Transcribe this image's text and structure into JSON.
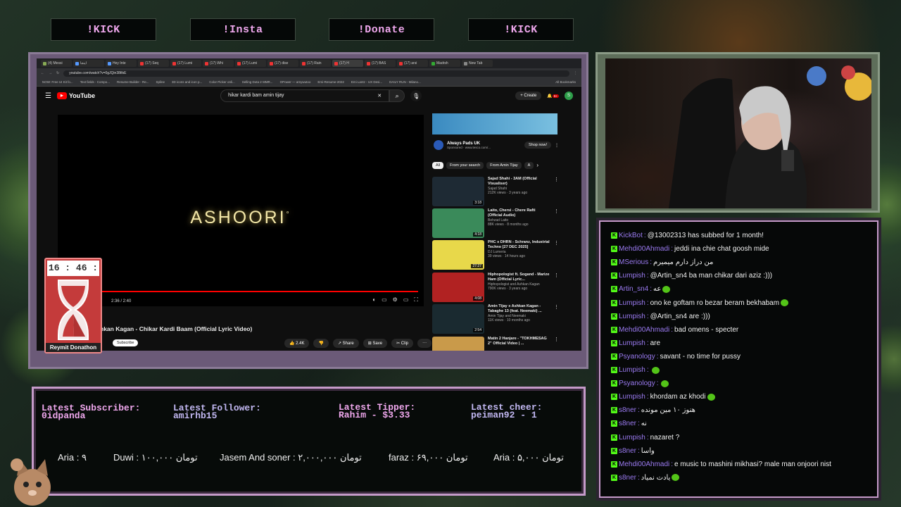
{
  "top_buttons": [
    "!KICK",
    "!Insta",
    "!Donate",
    "!KICK"
  ],
  "browser": {
    "tabs": [
      "(4) Messi",
      "اینجا",
      "Hey Inte",
      "(17) Seq",
      "(17) Lumi",
      "(17) Whi",
      "(17) Lumi",
      "(17) dise",
      "(17) Rain",
      "(17) H",
      "(17) BAS",
      "(17) arsi",
      "Madrsh",
      "New Tab"
    ],
    "url": "youtube.com/watch?v=0gJQin38tfsE",
    "bookmarks": [
      "NOW: Free UI Kit fo...",
      "Text fields - Compo...",
      "Resume Builder - Re...",
      "Spline",
      "3D icons and icon p...",
      "Color Picker onli...",
      "Selling Dota 2 MMR...",
      "OPower — amywutoo",
      "Emi-Resume-2022",
      "Emi Lantz - UX Desi...",
      "DAILY RUN - Milano...",
      "All Bookmarks"
    ]
  },
  "youtube": {
    "logo_text": "YouTube",
    "search_value": "hikar kardi bam amin tijay",
    "create_label": "Create",
    "notif_count": "9+",
    "avatar_letter": "S",
    "video_overlay_text": "ASHOORI",
    "video_overlay_symbol": "°",
    "time": "2:36 / 2:40",
    "title": "hkan Kagan - Chikar Kardi Baam (Official Lyric Video)",
    "subscribe": "Subscribe",
    "actions": [
      "2.4K",
      "",
      "Share",
      "Save",
      "Clip",
      "···"
    ],
    "ad": {
      "name": "Always Pads UK",
      "sponsor": "Sponsored · www.tesco.com/...",
      "button": "Shop now!"
    },
    "chips": [
      "All",
      "From your search",
      "From Amin Tijay",
      "A"
    ],
    "recommendations": [
      {
        "title": "Sajad Shahi - 3AM (Official Visualiser)",
        "channel": "Sajad Shahi",
        "meta": "212K views · 3 years ago",
        "duration": "3:18",
        "color": "#1e2a34"
      },
      {
        "title": "Laito, Chersi - Chere Rafti (Official Audio)",
        "channel": "Behzad Laito",
        "meta": "88K views · 8 months ago",
        "duration": "4:18",
        "color": "#3a8a5a"
      },
      {
        "title": "PHC x DHRN - Schranz, Industrial Techno [27 DEC 2025]",
        "channel": "DJ Lumeria",
        "meta": "39 views · 14 hours ago",
        "duration": "27:27",
        "color": "#e8d84a"
      },
      {
        "title": "Hiphopologist ft. Sogand - Marize Ham (Official Lyric...",
        "channel": "Hiphopologist and Ashkan Kagan",
        "meta": "790K views · 3 years ago",
        "duration": "4:08",
        "color": "#b12222"
      },
      {
        "title": "Amin Tijay x Ashkan Kagan - Tabaghe 13 (feat. Neemaki) ...",
        "channel": "Amin Tijay and Neemaki",
        "meta": "11K views · 10 months ago",
        "duration": "2:54",
        "color": "#1a2a30"
      },
      {
        "title": "Matin 2 Hanjare - \"TOKHMESAG 2\" Official Video | ...",
        "channel": "",
        "meta": "",
        "duration": "",
        "color": "#c99a4a"
      }
    ]
  },
  "timer": {
    "time": "16 : 46 : 01",
    "name": "Reymit Donathon"
  },
  "chat": [
    {
      "user": "KickBot",
      "msg": "@13002313 has subbed for 1 month!"
    },
    {
      "user": "Mehdi00Ahmadi",
      "msg": "jeddi ina chie chat goosh mide"
    },
    {
      "user": "MSerious",
      "msg": "من دراز دارم میمیرم"
    },
    {
      "user": "Lumpish",
      "msg": "@Artin_sn4 ba man chikar dari aziz :)))"
    },
    {
      "user": "Artin_sn4",
      "msg": "عه"
    },
    {
      "user": "Lumpish",
      "msg": "ono ke goftam ro bezar beram bekhabam"
    },
    {
      "user": "Lumpish",
      "msg": "@Artin_sn4 are :)))"
    },
    {
      "user": "Mehdi00Ahmadi",
      "msg": "bad omens - specter"
    },
    {
      "user": "Lumpish",
      "msg": "are"
    },
    {
      "user": "Psyanology",
      "msg": "savant - no time for pussy"
    },
    {
      "user": "Lumpish",
      "msg": ""
    },
    {
      "user": "Psyanology",
      "msg": ""
    },
    {
      "user": "Lumpish",
      "msg": "khordam az khodi"
    },
    {
      "user": "s8ner",
      "msg": "هنوز ۱۰ مین مونده"
    },
    {
      "user": "s8ner",
      "msg": "نه"
    },
    {
      "user": "Lumpish",
      "msg": "nazaret ?"
    },
    {
      "user": "s8ner",
      "msg": "واسا"
    },
    {
      "user": "Mehdi00Ahmadi",
      "msg": "e music to mashini mikhasi? male man onjoori nist"
    },
    {
      "user": "s8ner",
      "msg": "یادت نمیاد"
    }
  ],
  "stats": {
    "subscriber": {
      "label": "Latest Subscriber:",
      "value": "0idpanda"
    },
    "follower": {
      "label": "Latest Follower:",
      "value": "amirhb15"
    },
    "tipper": {
      "label": "Latest Tipper:",
      "value": "Rahim - $3.33"
    },
    "cheer": {
      "label": "Latest cheer:",
      "value": "peiman92 - 1"
    }
  },
  "ticker": [
    "Aria : ۹",
    "Duwi : ۱۰۰,۰۰۰ تومان",
    "Jasem And soner : ۲,۰۰۰,۰۰۰ تومان",
    "faraz : ۶۹,۰۰۰ تومان",
    "Aria : ۵,۰۰۰ تومان"
  ],
  "colors": {
    "accent_pink": "#f0a8ee",
    "accent_lilac": "#c2b8f2",
    "kick_green": "#53fc18",
    "chat_user": "#9a7af0",
    "yt_red": "#ff0000"
  }
}
